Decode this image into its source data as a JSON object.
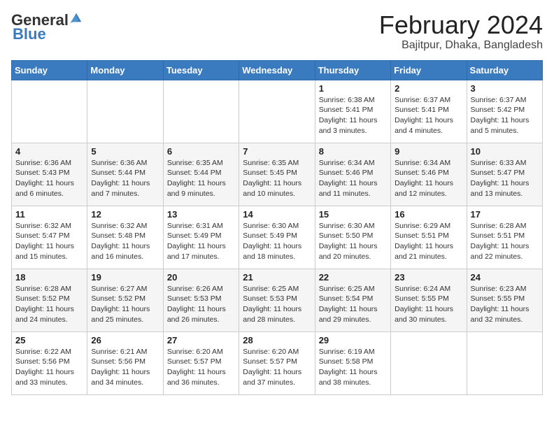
{
  "logo": {
    "general": "General",
    "blue": "Blue"
  },
  "title": "February 2024",
  "subtitle": "Bajitpur, Dhaka, Bangladesh",
  "days_of_week": [
    "Sunday",
    "Monday",
    "Tuesday",
    "Wednesday",
    "Thursday",
    "Friday",
    "Saturday"
  ],
  "weeks": [
    [
      {
        "day": "",
        "info": ""
      },
      {
        "day": "",
        "info": ""
      },
      {
        "day": "",
        "info": ""
      },
      {
        "day": "",
        "info": ""
      },
      {
        "day": "1",
        "info": "Sunrise: 6:38 AM\nSunset: 5:41 PM\nDaylight: 11 hours and 3 minutes."
      },
      {
        "day": "2",
        "info": "Sunrise: 6:37 AM\nSunset: 5:41 PM\nDaylight: 11 hours and 4 minutes."
      },
      {
        "day": "3",
        "info": "Sunrise: 6:37 AM\nSunset: 5:42 PM\nDaylight: 11 hours and 5 minutes."
      }
    ],
    [
      {
        "day": "4",
        "info": "Sunrise: 6:36 AM\nSunset: 5:43 PM\nDaylight: 11 hours and 6 minutes."
      },
      {
        "day": "5",
        "info": "Sunrise: 6:36 AM\nSunset: 5:44 PM\nDaylight: 11 hours and 7 minutes."
      },
      {
        "day": "6",
        "info": "Sunrise: 6:35 AM\nSunset: 5:44 PM\nDaylight: 11 hours and 9 minutes."
      },
      {
        "day": "7",
        "info": "Sunrise: 6:35 AM\nSunset: 5:45 PM\nDaylight: 11 hours and 10 minutes."
      },
      {
        "day": "8",
        "info": "Sunrise: 6:34 AM\nSunset: 5:46 PM\nDaylight: 11 hours and 11 minutes."
      },
      {
        "day": "9",
        "info": "Sunrise: 6:34 AM\nSunset: 5:46 PM\nDaylight: 11 hours and 12 minutes."
      },
      {
        "day": "10",
        "info": "Sunrise: 6:33 AM\nSunset: 5:47 PM\nDaylight: 11 hours and 13 minutes."
      }
    ],
    [
      {
        "day": "11",
        "info": "Sunrise: 6:32 AM\nSunset: 5:47 PM\nDaylight: 11 hours and 15 minutes."
      },
      {
        "day": "12",
        "info": "Sunrise: 6:32 AM\nSunset: 5:48 PM\nDaylight: 11 hours and 16 minutes."
      },
      {
        "day": "13",
        "info": "Sunrise: 6:31 AM\nSunset: 5:49 PM\nDaylight: 11 hours and 17 minutes."
      },
      {
        "day": "14",
        "info": "Sunrise: 6:30 AM\nSunset: 5:49 PM\nDaylight: 11 hours and 18 minutes."
      },
      {
        "day": "15",
        "info": "Sunrise: 6:30 AM\nSunset: 5:50 PM\nDaylight: 11 hours and 20 minutes."
      },
      {
        "day": "16",
        "info": "Sunrise: 6:29 AM\nSunset: 5:51 PM\nDaylight: 11 hours and 21 minutes."
      },
      {
        "day": "17",
        "info": "Sunrise: 6:28 AM\nSunset: 5:51 PM\nDaylight: 11 hours and 22 minutes."
      }
    ],
    [
      {
        "day": "18",
        "info": "Sunrise: 6:28 AM\nSunset: 5:52 PM\nDaylight: 11 hours and 24 minutes."
      },
      {
        "day": "19",
        "info": "Sunrise: 6:27 AM\nSunset: 5:52 PM\nDaylight: 11 hours and 25 minutes."
      },
      {
        "day": "20",
        "info": "Sunrise: 6:26 AM\nSunset: 5:53 PM\nDaylight: 11 hours and 26 minutes."
      },
      {
        "day": "21",
        "info": "Sunrise: 6:25 AM\nSunset: 5:53 PM\nDaylight: 11 hours and 28 minutes."
      },
      {
        "day": "22",
        "info": "Sunrise: 6:25 AM\nSunset: 5:54 PM\nDaylight: 11 hours and 29 minutes."
      },
      {
        "day": "23",
        "info": "Sunrise: 6:24 AM\nSunset: 5:55 PM\nDaylight: 11 hours and 30 minutes."
      },
      {
        "day": "24",
        "info": "Sunrise: 6:23 AM\nSunset: 5:55 PM\nDaylight: 11 hours and 32 minutes."
      }
    ],
    [
      {
        "day": "25",
        "info": "Sunrise: 6:22 AM\nSunset: 5:56 PM\nDaylight: 11 hours and 33 minutes."
      },
      {
        "day": "26",
        "info": "Sunrise: 6:21 AM\nSunset: 5:56 PM\nDaylight: 11 hours and 34 minutes."
      },
      {
        "day": "27",
        "info": "Sunrise: 6:20 AM\nSunset: 5:57 PM\nDaylight: 11 hours and 36 minutes."
      },
      {
        "day": "28",
        "info": "Sunrise: 6:20 AM\nSunset: 5:57 PM\nDaylight: 11 hours and 37 minutes."
      },
      {
        "day": "29",
        "info": "Sunrise: 6:19 AM\nSunset: 5:58 PM\nDaylight: 11 hours and 38 minutes."
      },
      {
        "day": "",
        "info": ""
      },
      {
        "day": "",
        "info": ""
      }
    ]
  ]
}
